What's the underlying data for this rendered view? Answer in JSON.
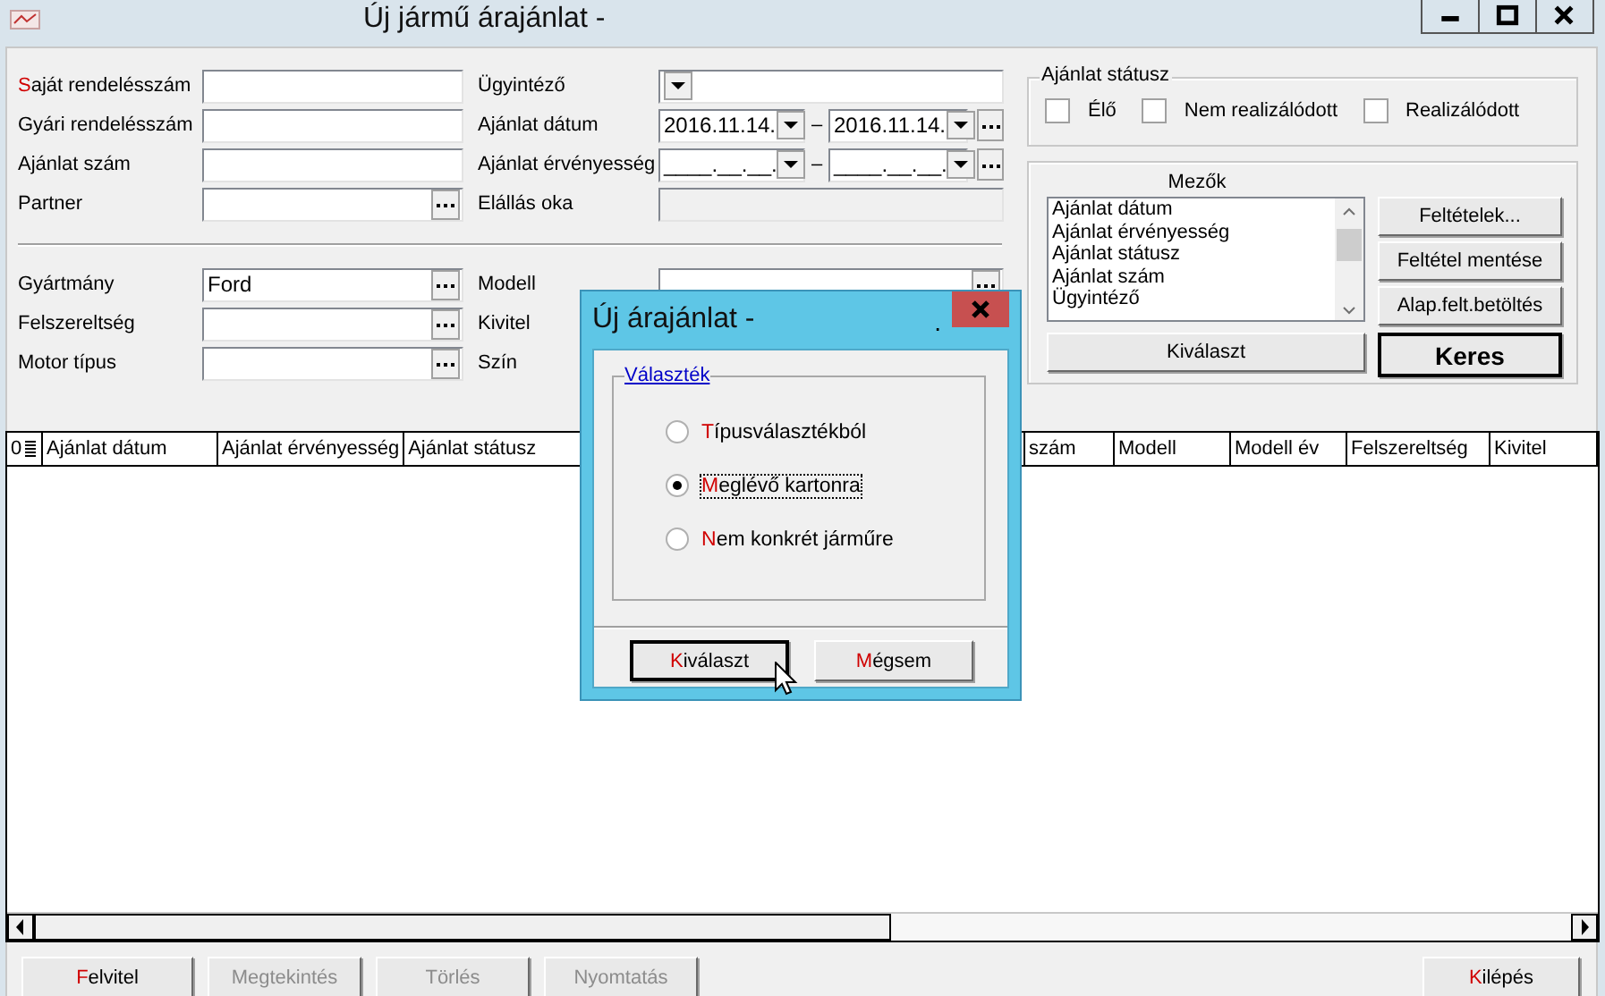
{
  "window": {
    "title": "Új jármű árajánlat -"
  },
  "order_fields": [
    {
      "kind": "text",
      "accel": "S",
      "label": "aját rendelésszám"
    },
    {
      "kind": "text",
      "label": "Gyári rendelésszám"
    },
    {
      "kind": "text",
      "label": "Ajánlat szám"
    },
    {
      "kind": "lookup",
      "label": "Partner"
    }
  ],
  "offer_fields": [
    {
      "kind": "combo",
      "label": "Ügyintéző"
    },
    {
      "kind": "daterange",
      "label": "Ajánlat dátum",
      "from": "2016.11.14.",
      "separator": "–",
      "to": "2016.11.14."
    },
    {
      "kind": "daterange",
      "label": "Ajánlat érvényesség",
      "from": "____.__.__.",
      "separator": "–",
      "to": "____.__.__."
    },
    {
      "kind": "readonly",
      "label": "Elállás oka"
    }
  ],
  "vehicle_fields": [
    {
      "kind": "lookup",
      "label": "Gyártmány",
      "value": "Ford"
    },
    {
      "kind": "lookup",
      "label": "Felszereltség"
    },
    {
      "kind": "lookup",
      "label": "Motor típus"
    }
  ],
  "vehicle_fields_right": [
    {
      "kind": "lookup",
      "label": "Modell"
    },
    {
      "kind": "covered",
      "label": "Kivitel"
    },
    {
      "kind": "covered",
      "label": "Szín"
    }
  ],
  "offer_status": {
    "title": "Ajánlat státusz",
    "options": [
      {
        "label": "Élő",
        "checked": false
      },
      {
        "label": "Nem realizálódott",
        "checked": false
      },
      {
        "label": "Realizálódott",
        "checked": false
      }
    ]
  },
  "fields_panel": {
    "title": "Mezők",
    "items": [
      "Ajánlat dátum",
      "Ajánlat érvényesség",
      "Ajánlat státusz",
      "Ajánlat szám",
      "Ügyintéző"
    ],
    "buttons": [
      "Feltételek...",
      "Feltétel mentése",
      "Alap.felt.betöltés"
    ],
    "select_button": "Kiválaszt",
    "search_button": "Keres"
  },
  "table": {
    "row_header": "0",
    "columns": [
      "Ajánlat dátum",
      "Ajánlat érvényesség",
      "Ajánlat státusz",
      "szám",
      "Modell",
      "Modell év",
      "Felszereltség",
      "Kivitel"
    ]
  },
  "buttons": [
    {
      "accel": "F",
      "label": "elvitel",
      "disabled": false
    },
    {
      "label": "Megtekintés",
      "disabled": true
    },
    {
      "label": "Törlés",
      "disabled": true
    },
    {
      "label": "Nyomtatás",
      "disabled": true
    },
    {
      "accel": "K",
      "label": "ilépés",
      "disabled": false
    }
  ],
  "dialog": {
    "title": "Új árajánlat -",
    "title_suffix": ".",
    "group": "Választék",
    "options": [
      {
        "accel": "T",
        "label": "ípusválasztékból",
        "selected": false
      },
      {
        "accel": "M",
        "label": "eglévő kartonra",
        "selected": true
      },
      {
        "accel": "N",
        "label": "em konkrét járműre",
        "selected": false
      }
    ],
    "buttons": [
      {
        "accel": "K",
        "label": "iválaszt",
        "default": true
      },
      {
        "accel": "M",
        "label": "égsem",
        "default": false
      }
    ]
  }
}
